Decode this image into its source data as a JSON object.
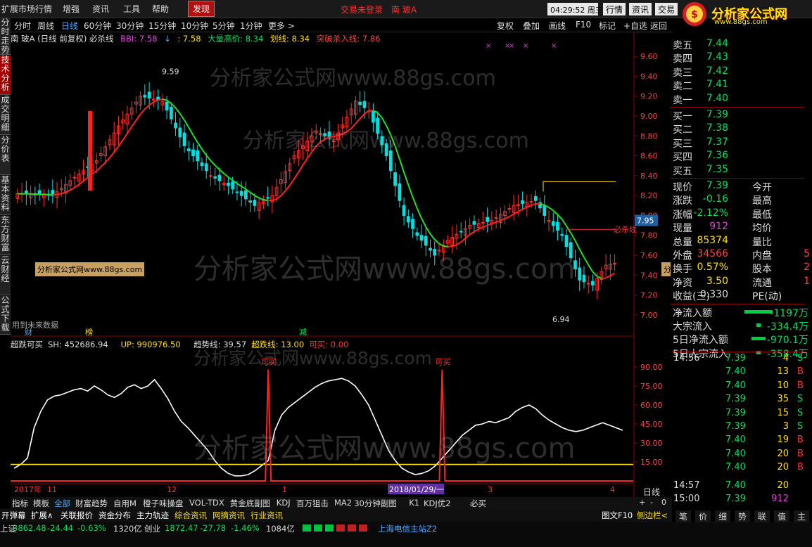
{
  "topbar": {
    "menu": [
      "扩展市场行情",
      "增强",
      "资讯",
      "工具",
      "帮助",
      "发现"
    ],
    "active_menu": "发现",
    "login_msg": "交易未登录　南 玻A",
    "clock": "04:29:52 周三",
    "right_buttons": [
      "行情",
      "资讯",
      "交易"
    ],
    "logo_title": "分析家公式网",
    "logo_url": "www.88gs.com"
  },
  "sidebar": {
    "tabs": [
      "分时走势",
      "技术分析",
      "成交明细",
      "分价表",
      "基本资料",
      "东方财富",
      "云财经",
      "公式下载"
    ],
    "active": "技术分析"
  },
  "periodbar": {
    "tabs": [
      "分时",
      "周线",
      "日线",
      "60分钟",
      "30分钟",
      "15分钟",
      "10分钟",
      "5分钟",
      "1分钟",
      "更多 >"
    ],
    "active": "日线",
    "right_buttons": [
      "复权",
      "叠加",
      "画线",
      "F10",
      "标记",
      "+自选",
      "返回"
    ]
  },
  "infoline": {
    "stock": "南 玻A (日线 前复权) 必杀线",
    "bbi": "BBI: 7.58",
    "bbi_val2": ": 7.58",
    "big_high": "大量高价: 8.34",
    "kill_line": "划线: 8.34",
    "breakout": "突破杀入线: 7.86"
  },
  "chart_data": [
    {
      "type": "candlestick",
      "title": "南 玻A (日线 前复权) 必杀线",
      "ylim": [
        6.9,
        9.7
      ],
      "yticks": [
        "9.60",
        "9.40",
        "9.20",
        "9.00",
        "8.80",
        "8.60",
        "8.40",
        "8.20",
        "8.00",
        "7.80",
        "7.60",
        "7.40",
        "7.20",
        "7.00"
      ],
      "current_price_tag": "7.95",
      "annotations": [
        "9.59",
        "6.94",
        "必杀线",
        "用到未来数据",
        "财",
        "榜",
        "减"
      ],
      "x_labels": [
        "2017年",
        "11",
        "12",
        "1",
        "2018/01/29/一",
        "3",
        "4"
      ],
      "bbi_segments": [
        "red",
        "green",
        "red",
        "green",
        "red",
        "green"
      ]
    },
    {
      "type": "line",
      "title": "超跌可买",
      "legend": [
        "SH: 452686.94",
        "UP: 990976.50",
        "趋势线: 39.57",
        "超跌线: 13.00",
        "可买: 0.00"
      ],
      "ylim": [
        0,
        100
      ],
      "yticks": [
        "90.00",
        "75.00",
        "60.00",
        "45.00",
        "30.00",
        "15.00"
      ],
      "annotations": [
        "可买",
        "可买"
      ],
      "trend_values": [
        10,
        13,
        18,
        42,
        55,
        64,
        67,
        68,
        70,
        72,
        73,
        71,
        75,
        72,
        68,
        66,
        69,
        74,
        76,
        73,
        75,
        80,
        73,
        65,
        55,
        47,
        42,
        36,
        30,
        24,
        16,
        10,
        6,
        4,
        4,
        5,
        8,
        12,
        16,
        40,
        52,
        58,
        62,
        66,
        70,
        74,
        77,
        79,
        80,
        81,
        79,
        75,
        68,
        60,
        48,
        36,
        24,
        16,
        10,
        7,
        5,
        6,
        8,
        12,
        18,
        24,
        30,
        36,
        40,
        44,
        45,
        47,
        46,
        48,
        50,
        55,
        58,
        60,
        57,
        52,
        48,
        45,
        42,
        40,
        39,
        40,
        42,
        44,
        46,
        44,
        42,
        40
      ],
      "level_line": 13,
      "buy_signals": [
        38,
        64
      ]
    }
  ],
  "orderbook": {
    "asks": [
      {
        "label": "卖五",
        "price": "7.44"
      },
      {
        "label": "卖四",
        "price": "7.43"
      },
      {
        "label": "卖三",
        "price": "7.42"
      },
      {
        "label": "卖二",
        "price": "7.41"
      },
      {
        "label": "卖一",
        "price": "7.40"
      }
    ],
    "bids": [
      {
        "label": "买一",
        "price": "7.39"
      },
      {
        "label": "买二",
        "price": "7.38"
      },
      {
        "label": "买三",
        "price": "7.37"
      },
      {
        "label": "买四",
        "price": "7.36"
      },
      {
        "label": "买五",
        "price": "7.35"
      }
    ],
    "stats": [
      {
        "l": "现价",
        "v": "7.39",
        "l2": "今开",
        "v2": "",
        "vc": "#00e060"
      },
      {
        "l": "涨跌",
        "v": "-0.16",
        "l2": "最高",
        "v2": "",
        "vc": "#00e060"
      },
      {
        "l": "涨幅",
        "v": "-2.12%",
        "l2": "最低",
        "v2": "",
        "vc": "#00e060"
      },
      {
        "l": "现量",
        "v": "912",
        "l2": "均价",
        "v2": "",
        "vc": "#e040e0"
      },
      {
        "l": "总量",
        "v": "85374",
        "l2": "量比",
        "v2": "",
        "vc": "#ffe000"
      },
      {
        "l": "外盘",
        "v": "34566",
        "l2": "内盘",
        "v2": "5",
        "vc": "#ff4040"
      },
      {
        "l": "换手",
        "v": "0.57%",
        "l2": "股本",
        "v2": "2",
        "vc": "#ffe000"
      },
      {
        "l": "净资",
        "v": "3.50",
        "l2": "流通",
        "v2": "1",
        "vc": "#ffe000"
      },
      {
        "l": "收益(三)",
        "v": "0.330",
        "l2": "PE(动)",
        "v2": "",
        "vc": "#dddddd"
      }
    ],
    "flows": [
      {
        "l": "净流入额",
        "v": "-1197万"
      },
      {
        "l": "大宗流入",
        "v": "-334.4万"
      },
      {
        "l": "5日净流入额",
        "v": "-970.1万"
      },
      {
        "l": "5日大宗流入",
        "v": "-358.4万"
      }
    ],
    "ticks": [
      {
        "t": "14:56",
        "p": "7.39",
        "v": "4",
        "s": "S"
      },
      {
        "t": "",
        "p": "7.40",
        "v": "13",
        "s": "B"
      },
      {
        "t": "",
        "p": "7.40",
        "v": "10",
        "s": "B"
      },
      {
        "t": "",
        "p": "7.39",
        "v": "35",
        "s": "S"
      },
      {
        "t": "",
        "p": "7.39",
        "v": "15",
        "s": "S"
      },
      {
        "t": "",
        "p": "7.39",
        "v": "3",
        "s": "S"
      },
      {
        "t": "",
        "p": "7.40",
        "v": "19",
        "s": "B"
      },
      {
        "t": "",
        "p": "7.40",
        "v": "20",
        "s": "B"
      },
      {
        "t": "",
        "p": "7.40",
        "v": "20",
        "s": "B"
      },
      {
        "t": "14:57",
        "p": "7.40",
        "v": "20",
        "s": ""
      },
      {
        "t": "15:00",
        "p": "7.39",
        "v": "912",
        "s": ""
      }
    ],
    "side_label": "日线",
    "zoom_controls": [
      "+",
      "-",
      "0"
    ]
  },
  "bottomtabs": {
    "tabs": [
      "指标",
      "模板",
      "全部",
      "财富趋势",
      "自用M",
      "橙子味操盘",
      "VOL-TDX",
      "黄金底副图",
      "KDJ",
      "百万狙击",
      "MA2",
      "30分钟副图",
      "K1",
      "KDJ优2",
      "必买"
    ],
    "active": "全部"
  },
  "newsbar": {
    "items": [
      "开弹幕",
      "扩展∧",
      "关联报价",
      "资金分布",
      "主力轨迹",
      "综合资讯",
      "网摘资讯",
      "行业资讯"
    ],
    "right": "图文F10",
    "right2": "侧边栏<"
  },
  "statusbar": {
    "sh_label": "上证",
    "sh_val": "3862.48",
    "sh_chg": "-24.44",
    "sh_pct": "-0.63%",
    "sh_amt": "1320亿",
    "cy_label": "创业",
    "cy_val": "1872.47",
    "cy_chg": "-27.78",
    "cy_pct": "-1.46%",
    "cy_amt": "1084亿",
    "server": "上海电信主站Z2",
    "right_tabs": [
      "笔",
      "价",
      "细",
      "势",
      "联",
      "值",
      "主"
    ]
  },
  "watermark": "分析家公式网www.88gs.com",
  "badge": "分析家公式网www.88gs.com"
}
